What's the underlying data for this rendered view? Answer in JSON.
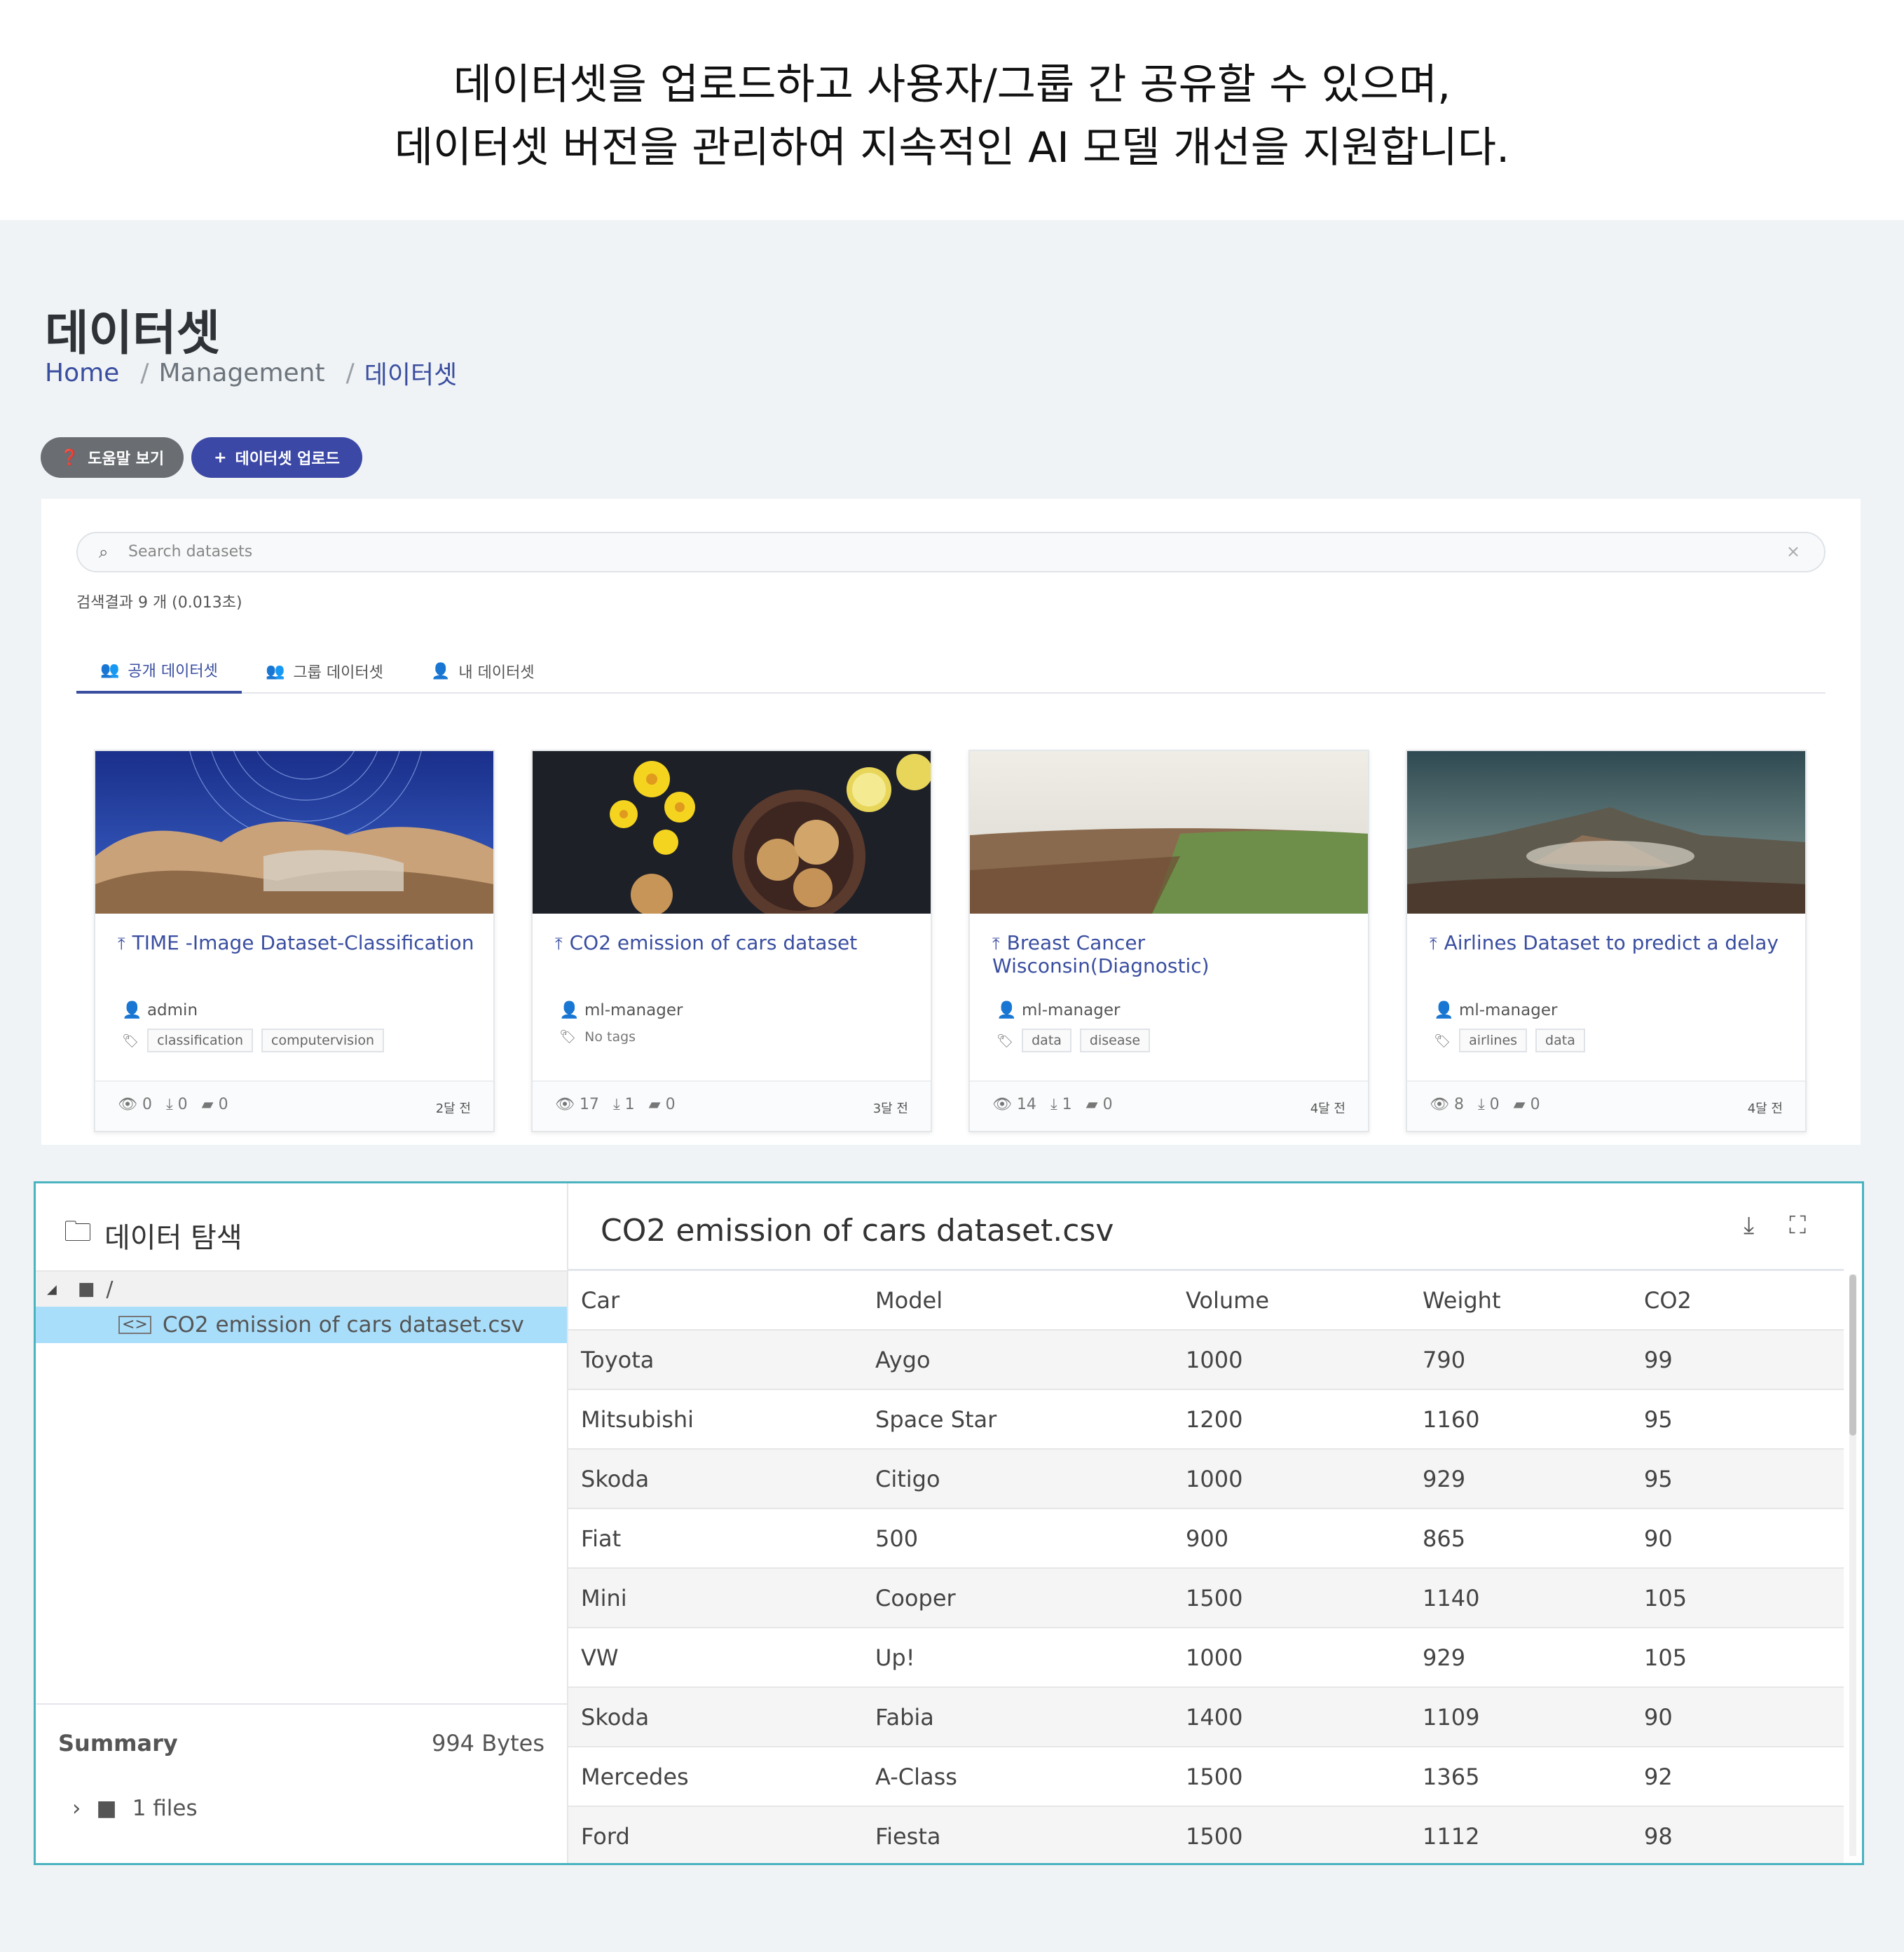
{
  "banner": {
    "line1": "데이터셋을 업로드하고 사용자/그룹 간 공유할 수 있으며,",
    "line2": "데이터셋 버전을 관리하여 지속적인 AI 모델 개선을 지원합니다."
  },
  "page": {
    "title": "데이터셋",
    "breadcrumb": [
      "Home",
      "Management",
      "데이터셋"
    ],
    "breadcrumb_separator": "/"
  },
  "toolbar": {
    "help_label": "도움말 보기",
    "upload_label": "데이터셋 업로드"
  },
  "search": {
    "placeholder": "Search datasets",
    "result_count": "검색결과 9 개 (0.013초)"
  },
  "tabs": [
    {
      "label": "공개 데이터셋",
      "active": true
    },
    {
      "label": "그룹 데이터셋",
      "active": false
    },
    {
      "label": "내 데이터셋",
      "active": false
    }
  ],
  "cards": [
    {
      "title": "TIME -Image Dataset-Classification",
      "owner": "admin",
      "tags": [
        "classification",
        "computervision"
      ],
      "views": "0",
      "downloads": "0",
      "comments": "0",
      "age": "2달 전"
    },
    {
      "title": "CO2 emission of cars dataset",
      "owner": "ml-manager",
      "tags": [],
      "no_tags": "No tags",
      "views": "17",
      "downloads": "1",
      "comments": "0",
      "age": "3달 전"
    },
    {
      "title": "Breast Cancer Wisconsin(Diagnostic)",
      "owner": "ml-manager",
      "tags": [
        "data",
        "disease"
      ],
      "views": "14",
      "downloads": "1",
      "comments": "0",
      "age": "4달 전"
    },
    {
      "title": "Airlines Dataset to predict a delay",
      "owner": "ml-manager",
      "tags": [
        "airlines",
        "data"
      ],
      "views": "8",
      "downloads": "0",
      "comments": "0",
      "age": "4달 전"
    }
  ],
  "explorer": {
    "title": "데이터 탐색",
    "tree_root": "/",
    "selected_file": "CO2 emission of cars dataset.csv",
    "summary_label": "Summary",
    "summary_size": "994 Bytes",
    "summary_files": "1 files",
    "file_title": "CO2 emission of cars dataset.csv"
  },
  "table": {
    "headers": [
      "Car",
      "Model",
      "Volume",
      "Weight",
      "CO2"
    ],
    "rows": [
      [
        "Toyota",
        "Aygo",
        "1000",
        "790",
        "99"
      ],
      [
        "Mitsubishi",
        "Space Star",
        "1200",
        "1160",
        "95"
      ],
      [
        "Skoda",
        "Citigo",
        "1000",
        "929",
        "95"
      ],
      [
        "Fiat",
        "500",
        "900",
        "865",
        "90"
      ],
      [
        "Mini",
        "Cooper",
        "1500",
        "1140",
        "105"
      ],
      [
        "VW",
        "Up!",
        "1000",
        "929",
        "105"
      ],
      [
        "Skoda",
        "Fabia",
        "1400",
        "1109",
        "90"
      ],
      [
        "Mercedes",
        "A-Class",
        "1500",
        "1365",
        "92"
      ],
      [
        "Ford",
        "Fiesta",
        "1500",
        "1112",
        "98"
      ]
    ]
  },
  "icons": {
    "help": "question-circle-icon",
    "upload": "plus-icon",
    "search": "search-icon",
    "clear": "close-icon",
    "public": "users-icon",
    "group": "group-icon",
    "mine": "user-icon",
    "pin": "upload-arrow-icon",
    "folder": "folder-icon",
    "file": "file-code-icon",
    "download": "download-icon",
    "fullscreen": "fullscreen-icon"
  },
  "colors": {
    "accent": "#3a4ea0",
    "help_button": "#6a6e72",
    "explorer_border": "#4ab3c0",
    "selected_row": "#a9defb"
  }
}
